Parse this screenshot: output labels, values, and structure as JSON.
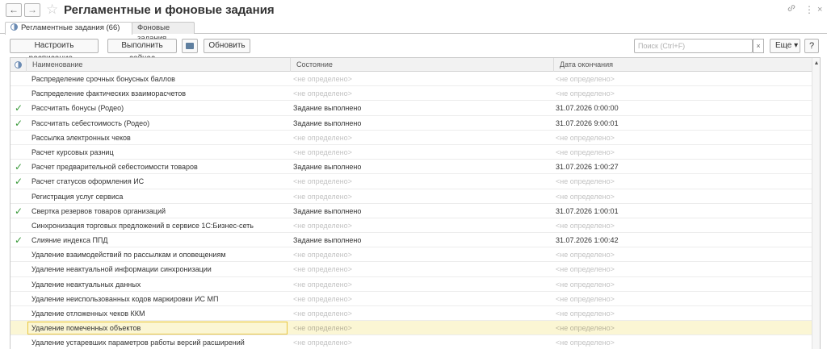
{
  "window": {
    "title": "Регламентные и фоновые задания",
    "back_icon": "←",
    "forward_icon": "→",
    "favorite_icon": "☆",
    "link_icon": "🔗",
    "more_icon": "⋮",
    "close_icon": "×"
  },
  "tabs": [
    {
      "label": "Регламентные задания (66)",
      "active": true
    },
    {
      "label": "Фоновые задания",
      "active": false
    }
  ],
  "toolbar": {
    "schedule_label": "Настроить расписание...",
    "run_label": "Выполнить сейчас",
    "refresh_label": "Обновить",
    "search_placeholder": "Поиск (Ctrl+F)",
    "search_clear": "×",
    "more_label": "Еще ▾",
    "help_label": "?"
  },
  "table": {
    "columns": [
      "Наименование",
      "Состояние",
      "Дата окончания"
    ],
    "check_mark": "✓",
    "rows": [
      {
        "done": false,
        "name": "Распределение срочных бонусных баллов",
        "state": "<не определено>",
        "date": "<не определено>"
      },
      {
        "done": false,
        "name": "Распределение фактических взаиморасчетов",
        "state": "<не определено>",
        "date": "<не определено>"
      },
      {
        "done": true,
        "name": "Рассчитать бонусы (Родео)",
        "state": "Задание выполнено",
        "date": "31.07.2026 0:00:00"
      },
      {
        "done": true,
        "name": "Рассчитать себестоимость (Родео)",
        "state": "Задание выполнено",
        "date": "31.07.2026 9:00:01"
      },
      {
        "done": false,
        "name": "Рассылка электронных чеков",
        "state": "<не определено>",
        "date": "<не определено>"
      },
      {
        "done": false,
        "name": "Расчет курсовых разниц",
        "state": "<не определено>",
        "date": "<не определено>"
      },
      {
        "done": true,
        "name": "Расчет предварительной себестоимости товаров",
        "state": "Задание выполнено",
        "date": "31.07.2026 1:00:27"
      },
      {
        "done": true,
        "name": "Расчет статусов оформления ИС",
        "state": "<не определено>",
        "date": "<не определено>"
      },
      {
        "done": false,
        "name": "Регистрация услуг сервиса",
        "state": "<не определено>",
        "date": "<не определено>"
      },
      {
        "done": true,
        "name": "Свертка резервов товаров организаций",
        "state": "Задание выполнено",
        "date": "31.07.2026 1:00:01"
      },
      {
        "done": false,
        "name": "Синхронизация торговых предложений в сервисе 1С:Бизнес-сеть",
        "state": "<не определено>",
        "date": "<не определено>"
      },
      {
        "done": true,
        "name": "Слияние индекса ППД",
        "state": "Задание выполнено",
        "date": "31.07.2026 1:00:42"
      },
      {
        "done": false,
        "name": "Удаление взаимодействий по рассылкам и оповещениям",
        "state": "<не определено>",
        "date": "<не определено>"
      },
      {
        "done": false,
        "name": "Удаление неактуальной информации синхронизации",
        "state": "<не определено>",
        "date": "<не определено>"
      },
      {
        "done": false,
        "name": "Удаление неактуальных данных",
        "state": "<не определено>",
        "date": "<не определено>"
      },
      {
        "done": false,
        "name": "Удаление неиспользованных кодов маркировки ИС МП",
        "state": "<не определено>",
        "date": "<не определено>"
      },
      {
        "done": false,
        "name": "Удаление отложенных чеков ККМ",
        "state": "<не определено>",
        "date": "<не определено>"
      },
      {
        "done": false,
        "name": "Удаление помеченных объектов",
        "state": "<не определено>",
        "date": "<не определено>",
        "selected": true
      },
      {
        "done": false,
        "name": "Удаление устаревших параметров работы версий расширений",
        "state": "<не определено>",
        "date": "<не определено>"
      }
    ]
  },
  "colors": {
    "check": "#3a9a3a",
    "selected_row": "#fbf6d4",
    "selected_border": "#e8c640"
  }
}
